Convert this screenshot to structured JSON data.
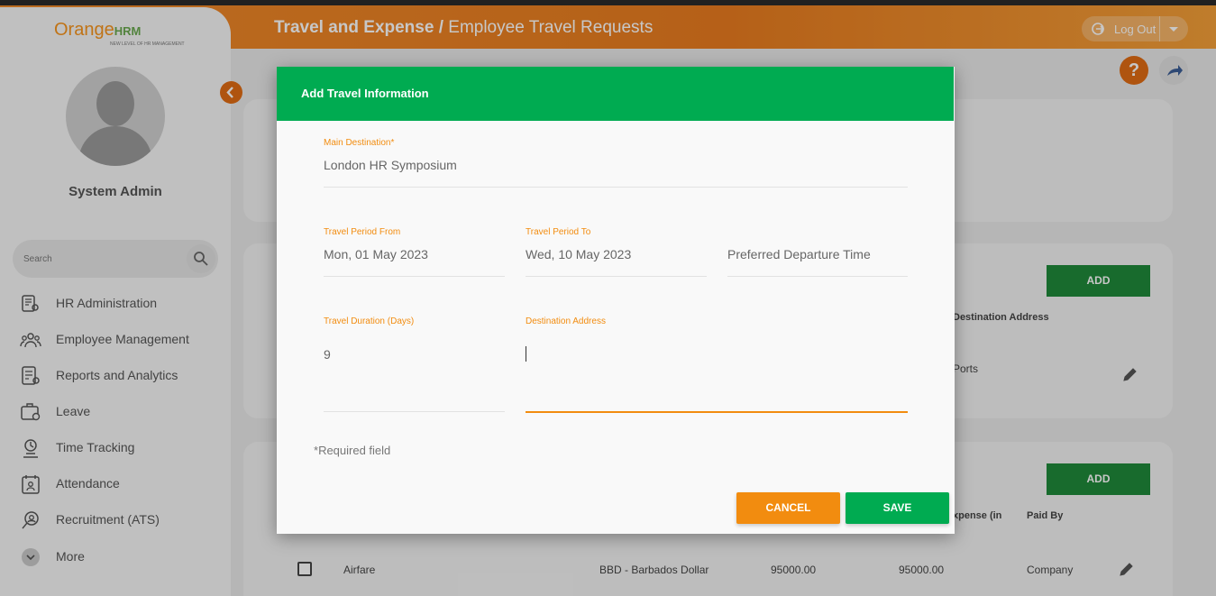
{
  "header": {
    "module": "Travel and Expense",
    "separator": " / ",
    "page": "Employee Travel Requests",
    "logout_label": "Log Out"
  },
  "sidebar": {
    "logo_main": "Orange",
    "logo_hrm": "HRM",
    "logo_tagline": "NEW LEVEL OF HR MANAGEMENT",
    "username": "System Admin",
    "search_placeholder": "Search",
    "items": [
      {
        "label": "HR Administration",
        "icon": "hr-admin-icon"
      },
      {
        "label": "Employee Management",
        "icon": "employees-icon"
      },
      {
        "label": "Reports and Analytics",
        "icon": "reports-icon"
      },
      {
        "label": "Leave",
        "icon": "leave-icon"
      },
      {
        "label": "Time Tracking",
        "icon": "time-icon"
      },
      {
        "label": "Attendance",
        "icon": "attendance-icon"
      },
      {
        "label": "Recruitment (ATS)",
        "icon": "recruitment-icon"
      },
      {
        "label": "More",
        "icon": "chevron-down-icon"
      }
    ]
  },
  "background": {
    "help_label": "?",
    "add_label_1": "ADD",
    "add_label_2": "ADD",
    "col_destination_address": "Destination Address",
    "row1_destination": "Ports",
    "col_expense": "xpense (in",
    "col_paid_by": "Paid By",
    "row2": {
      "type": "Airfare",
      "currency": "BBD - Barbados Dollar",
      "amount1": "95000.00",
      "amount2": "95000.00",
      "paid_by": "Company"
    }
  },
  "modal": {
    "title": "Add Travel Information",
    "main_destination": {
      "label": "Main Destination",
      "required_mark": "*",
      "value": "London HR Symposium"
    },
    "period_from": {
      "label": "Travel Period From",
      "value": "Mon, 01 May 2023"
    },
    "period_to": {
      "label": "Travel Period To",
      "value": "Wed, 10 May 2023"
    },
    "departure_time": {
      "placeholder": "Preferred Departure Time"
    },
    "duration": {
      "label": "Travel Duration (Days)",
      "value": "9"
    },
    "destination_address": {
      "label": "Destination Address",
      "value": ""
    },
    "required_note": "Required field",
    "required_star": "*",
    "cancel_label": "CANCEL",
    "save_label": "SAVE"
  },
  "colors": {
    "accent_green": "#00ab51",
    "accent_orange": "#f28c0f",
    "header_orange": "#e97c1f"
  }
}
